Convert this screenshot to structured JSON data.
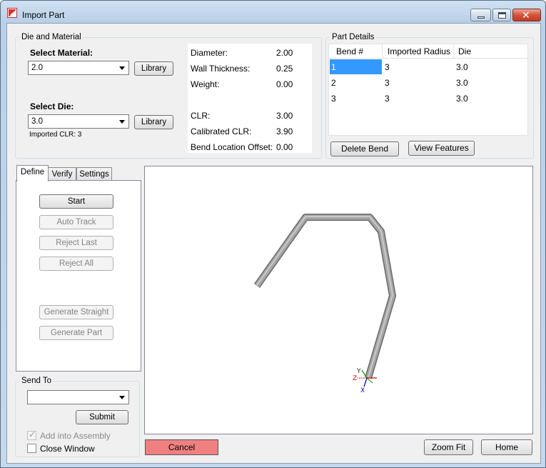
{
  "window": {
    "title": "Import Part"
  },
  "die_material": {
    "group_label": "Die and Material",
    "material_label": "Select Material:",
    "material_value": "2.0",
    "library_label": "Library",
    "die_label": "Select Die:",
    "die_value": "3.0",
    "imported_clr": "Imported CLR: 3"
  },
  "properties": {
    "diameter_label": "Diameter:",
    "diameter_value": "2.00",
    "wall_label": "Wall Thickness:",
    "wall_value": "0.25",
    "weight_label": "Weight:",
    "weight_value": "0.00",
    "clr_label": "CLR:",
    "clr_value": "3.00",
    "cal_clr_label": "Calibrated CLR:",
    "cal_clr_value": "3.90",
    "offset_label": "Bend Location Offset:",
    "offset_value": "0.00"
  },
  "part_details": {
    "group_label": "Part Details",
    "columns": [
      "Bend #",
      "Imported Radius",
      "Die"
    ],
    "rows": [
      [
        "1",
        "3",
        "3.0"
      ],
      [
        "2",
        "3",
        "3.0"
      ],
      [
        "3",
        "3",
        "3.0"
      ]
    ],
    "delete_label": "Delete Bend",
    "view_label": "View Features"
  },
  "tabs": [
    "Define",
    "Verify",
    "Settings"
  ],
  "define": {
    "start": "Start",
    "auto_track": "Auto Track",
    "reject_last": "Reject Last",
    "reject_all": "Reject All",
    "generate_straight": "Generate Straight",
    "generate_part": "Generate Part"
  },
  "send_to": {
    "group_label": "Send To",
    "value": "",
    "submit_label": "Submit",
    "add_assembly_label": "Add into Assembly",
    "add_assembly_checked": true,
    "close_window_label": "Close Window",
    "close_window_checked": false
  },
  "viewport": {
    "axes": {
      "x": "X",
      "y": "Y",
      "z": "Z"
    }
  },
  "footer": {
    "cancel": "Cancel",
    "zoom_fit": "Zoom Fit",
    "home": "Home"
  },
  "colors": {
    "cancel_bg": "#f08080",
    "selection": "#3399ff",
    "tube": "#9a9a9a"
  }
}
